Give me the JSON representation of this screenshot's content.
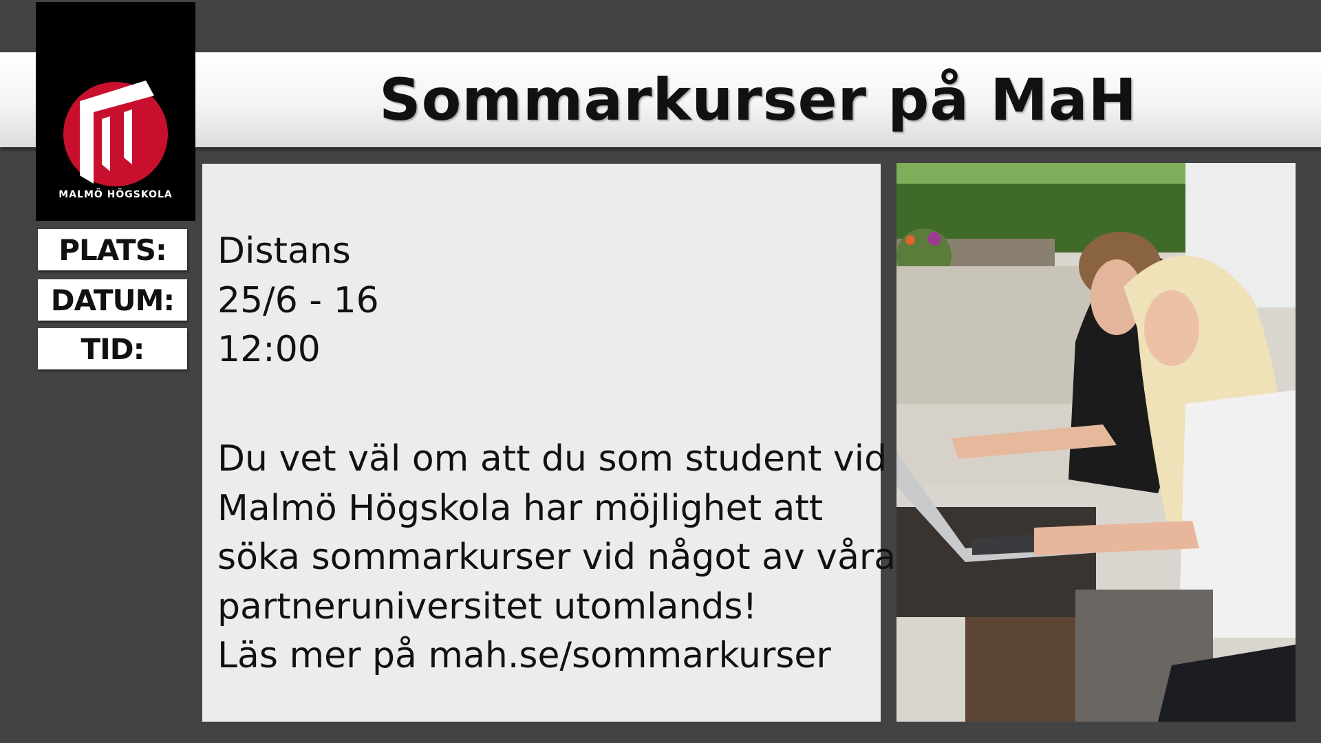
{
  "header": {
    "title": "Sommarkurser på MaH"
  },
  "logo": {
    "text": "MALMÖ HÖGSKOLA",
    "brand_color": "#c8102e"
  },
  "labels": {
    "place": "PLATS:",
    "date": "DATUM:",
    "time": "TID:"
  },
  "info": {
    "place": "Distans",
    "date": "25/6 - 16",
    "time": "12:00"
  },
  "body": {
    "lines": [
      "Du vet väl om att du som student vid",
      "Malmö Högskola har möjlighet att",
      "söka sommarkurser vid något av våra",
      "partneruniversitet utomlands!",
      "Läs mer på mah.se/sommarkurser"
    ]
  }
}
